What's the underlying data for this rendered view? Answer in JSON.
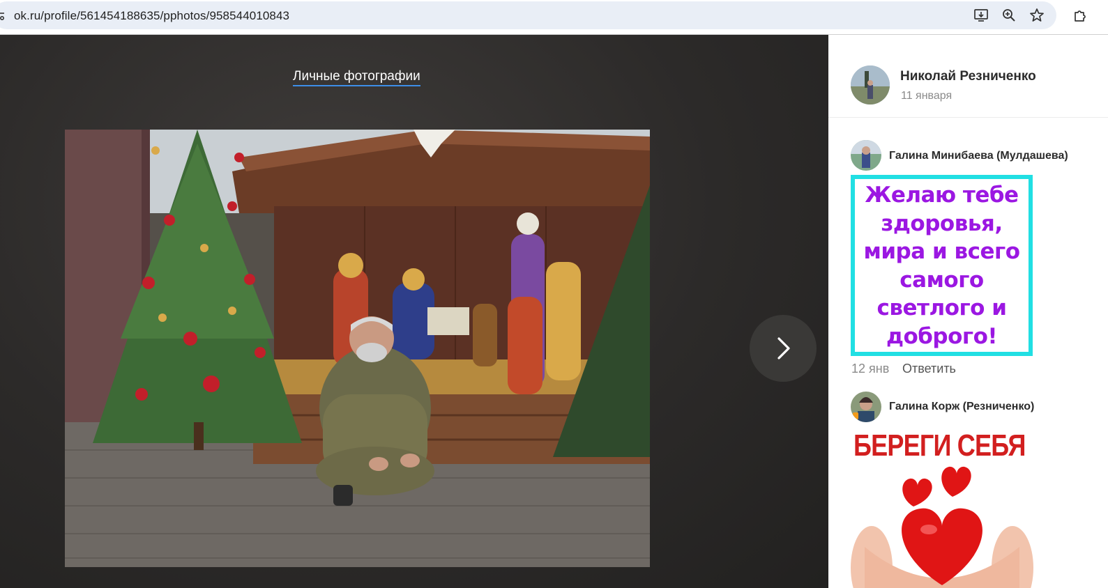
{
  "browser": {
    "url": "ok.ru/profile/561454188635/pphotos/958544010843",
    "icons": [
      "site-info-icon",
      "install-app-icon",
      "zoom-icon",
      "bookmark-star-icon",
      "extensions-icon"
    ]
  },
  "viewer": {
    "album_link": "Личные фотографии",
    "photo_icon": "photo-image",
    "next_icon": "chevron-right-icon"
  },
  "post": {
    "author_name": "Николай Резниченко",
    "date": "11 января"
  },
  "comments": [
    {
      "author": "Галина Минибаева (Мулдашева)",
      "card_text": "Желаю тебе здоровья, мира и всего самого светлого и доброго!",
      "card_lines": [
        "Желаю тебе",
        "здоровья,",
        "мира и всего",
        "самого",
        "светлого и",
        "доброго!"
      ],
      "card_border_color": "#21dfe3",
      "card_text_color": "#9b17e2",
      "date": "12 янв",
      "reply_label": "Ответить"
    },
    {
      "author": "Галина Корж (Резниченко)",
      "card_text": "БЕРЕГИ СЕБЯ",
      "card_text_color": "#d21f1f"
    }
  ]
}
